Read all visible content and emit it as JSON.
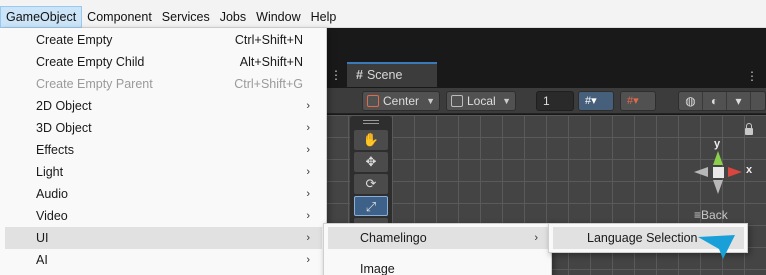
{
  "menubar": {
    "items": [
      "GameObject",
      "Component",
      "Services",
      "Jobs",
      "Window",
      "Help"
    ]
  },
  "gameobject_menu": {
    "items": [
      {
        "label": "Create Empty",
        "shortcut": "Ctrl+Shift+N"
      },
      {
        "label": "Create Empty Child",
        "shortcut": "Alt+Shift+N"
      },
      {
        "label": "Create Empty Parent",
        "shortcut": "Ctrl+Shift+G"
      },
      {
        "label": "2D Object"
      },
      {
        "label": "3D Object"
      },
      {
        "label": "Effects"
      },
      {
        "label": "Light"
      },
      {
        "label": "Audio"
      },
      {
        "label": "Video"
      },
      {
        "label": "UI"
      },
      {
        "label": "AI"
      }
    ]
  },
  "ui_submenu": {
    "items": [
      "Chamelingo",
      "Image"
    ]
  },
  "chamelingo_submenu": {
    "items": [
      "Language Selection"
    ]
  },
  "editor": {
    "tab_label": "Scene",
    "pivot_mode": "Center",
    "pivot_rotation": "Local",
    "grid_size": "1",
    "gizmo_y": "y",
    "gizmo_x": "x",
    "back_label": "Back",
    "grid_snap_icon": "grid-snap-icon",
    "accent_color": "#3a79bb"
  }
}
